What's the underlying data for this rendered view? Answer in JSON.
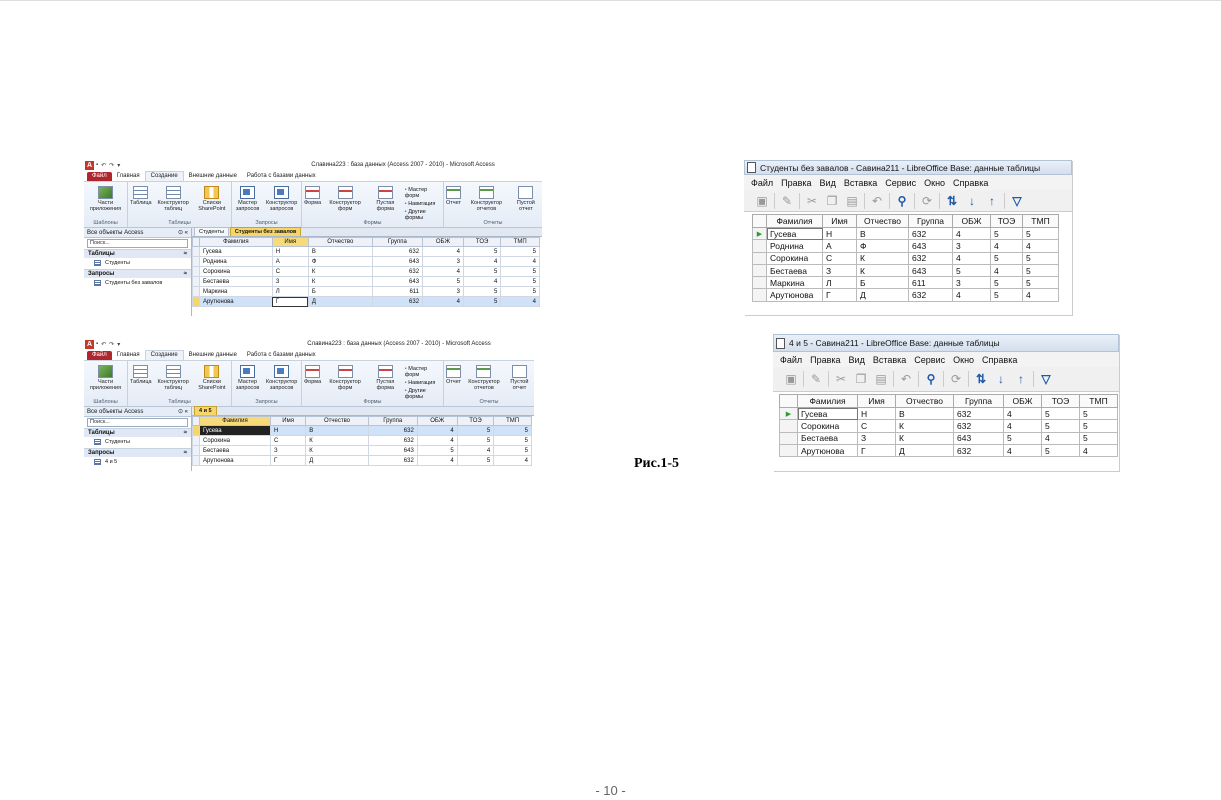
{
  "access1": {
    "window_title": "Славина223 : база данных (Access 2007 - 2010)  -  Microsoft Access",
    "tabs": [
      "Файл",
      "Главная",
      "Создание",
      "Внешние данные",
      "Работа с базами данных"
    ],
    "ribbon": {
      "templates": {
        "btn": "Части приложения",
        "label": "Шаблоны"
      },
      "tables": {
        "btns": [
          "Таблица",
          "Конструктор таблиц",
          "Списки SharePoint"
        ],
        "label": "Таблицы"
      },
      "queries": {
        "btns": [
          "Мастер запросов",
          "Конструктор запросов"
        ],
        "label": "Запросы"
      },
      "forms": {
        "btns": [
          "Форма",
          "Конструктор форм",
          "Пустая форма"
        ],
        "small": [
          "Мастер форм",
          "Навигация",
          "Другие формы"
        ],
        "label": "Формы"
      },
      "reports": {
        "btns": [
          "Отчет",
          "Конструктор отчетов",
          "Пустой отчет"
        ],
        "label": "Отчеты"
      }
    },
    "nav": {
      "header": "Все объекты Access",
      "search": "Поиск...",
      "sections": [
        {
          "title": "Таблицы",
          "items": [
            "Студенты"
          ]
        },
        {
          "title": "Запросы",
          "items": [
            "Студенты без завалов"
          ]
        }
      ]
    },
    "doc_tabs": [
      "Студенты",
      "Студенты без завалов"
    ],
    "columns": [
      "Фамилия",
      "Имя",
      "Отчество",
      "Группа",
      "ОБЖ",
      "ТОЭ",
      "ТМП"
    ],
    "rows": [
      [
        "Гусева",
        "Н",
        "В",
        "632",
        "4",
        "5",
        "5"
      ],
      [
        "Роднина",
        "А",
        "Ф",
        "643",
        "3",
        "4",
        "4"
      ],
      [
        "Сорокина",
        "С",
        "К",
        "632",
        "4",
        "5",
        "5"
      ],
      [
        "Бестаева",
        "З",
        "К",
        "643",
        "5",
        "4",
        "5"
      ],
      [
        "Маркина",
        "Л",
        "Б",
        "611",
        "3",
        "5",
        "5"
      ],
      [
        "Арутюнова",
        "Г",
        "Д",
        "632",
        "4",
        "5",
        "4"
      ]
    ]
  },
  "access2": {
    "window_title": "Славина223 : база данных (Access 2007 - 2010)  -  Microsoft Access",
    "tabs": [
      "Файл",
      "Главная",
      "Создание",
      "Внешние данные",
      "Работа с базами данных"
    ],
    "nav": {
      "header": "Все объекты Access",
      "search": "Поиск...",
      "sections": [
        {
          "title": "Таблицы",
          "items": [
            "Студенты"
          ]
        },
        {
          "title": "Запросы",
          "items": [
            "4 и 5"
          ]
        }
      ]
    },
    "doc_tabs": [
      "4 и 5"
    ],
    "columns": [
      "Фамилия",
      "Имя",
      "Отчество",
      "Группа",
      "ОБЖ",
      "ТОЭ",
      "ТМП"
    ],
    "rows": [
      [
        "Гусева",
        "Н",
        "В",
        "632",
        "4",
        "5",
        "5"
      ],
      [
        "Сорокина",
        "С",
        "К",
        "632",
        "4",
        "5",
        "5"
      ],
      [
        "Бестаева",
        "З",
        "К",
        "643",
        "5",
        "4",
        "5"
      ],
      [
        "Арутюнова",
        "Г",
        "Д",
        "632",
        "4",
        "5",
        "4"
      ]
    ]
  },
  "lo1": {
    "window_title": "Студенты без завалов - Савина211 - LibreOffice Base: данные таблицы",
    "menu": [
      "Файл",
      "Правка",
      "Вид",
      "Вставка",
      "Сервис",
      "Окно",
      "Справка"
    ],
    "columns": [
      "Фамилия",
      "Имя",
      "Отчество",
      "Группа",
      "ОБЖ",
      "ТОЭ",
      "ТМП"
    ],
    "rows": [
      [
        "Гусева",
        "Н",
        "В",
        "632",
        "4",
        "5",
        "5"
      ],
      [
        "Роднина",
        "А",
        "Ф",
        "643",
        "3",
        "4",
        "4"
      ],
      [
        "Сорокина",
        "С",
        "К",
        "632",
        "4",
        "5",
        "5"
      ],
      [
        "Бестаева",
        "З",
        "К",
        "643",
        "5",
        "4",
        "5"
      ],
      [
        "Маркина",
        "Л",
        "Б",
        "611",
        "3",
        "5",
        "5"
      ],
      [
        "Арутюнова",
        "Г",
        "Д",
        "632",
        "4",
        "5",
        "4"
      ]
    ]
  },
  "lo2": {
    "window_title": "4 и 5 - Савина211 - LibreOffice Base: данные таблицы",
    "menu": [
      "Файл",
      "Правка",
      "Вид",
      "Вставка",
      "Сервис",
      "Окно",
      "Справка"
    ],
    "columns": [
      "Фамилия",
      "Имя",
      "Отчество",
      "Группа",
      "ОБЖ",
      "ТОЭ",
      "ТМП"
    ],
    "rows": [
      [
        "Гусева",
        "Н",
        "В",
        "632",
        "4",
        "5",
        "5"
      ],
      [
        "Сорокина",
        "С",
        "К",
        "632",
        "4",
        "5",
        "5"
      ],
      [
        "Бестаева",
        "З",
        "К",
        "643",
        "5",
        "4",
        "5"
      ],
      [
        "Арутюнова",
        "Г",
        "Д",
        "632",
        "4",
        "5",
        "4"
      ]
    ]
  },
  "caption": "Рис.1-5",
  "page_number": "- 10 -"
}
